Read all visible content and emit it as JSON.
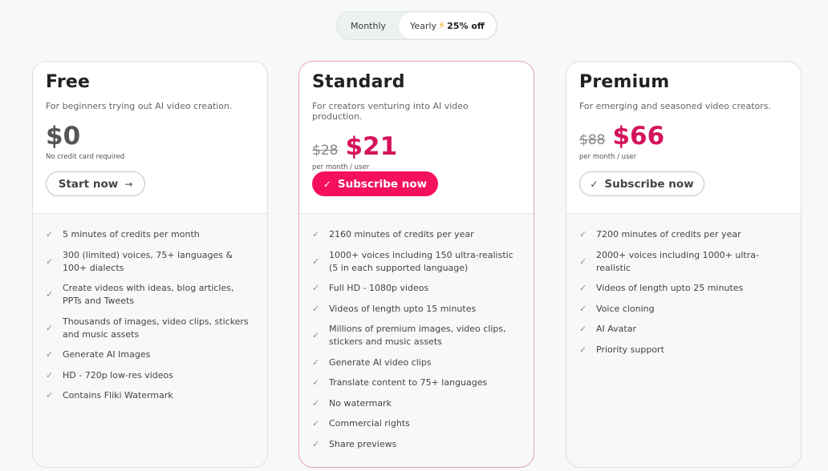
{
  "billing_toggle": {
    "monthly_label": "Monthly",
    "yearly_label": "Yearly",
    "discount_label": "25% off",
    "selected": "Yearly",
    "bolt_icon": "lightning-bolt-icon"
  },
  "plans": [
    {
      "name": "Free",
      "description": "For beginners trying out AI video creation.",
      "price": "$0",
      "price_note": "No credit card required",
      "cta_label": "Start now",
      "cta_icon": "→",
      "features": [
        "5 minutes of credits per month",
        "300 (limited) voices, 75+ languages & 100+ dialects",
        "Create videos with ideas, blog articles, PPTs and Tweets",
        "Thousands of images, video clips, stickers and music assets",
        "Generate AI Images",
        "HD - 720p low-res videos",
        "Contains Fliki Watermark"
      ]
    },
    {
      "name": "Standard",
      "description": "For creators venturing into AI video production.",
      "old_price": "$28",
      "price": "$21",
      "price_note": "per month / user",
      "cta_label": "Subscribe now",
      "cta_icon": "✓",
      "highlighted": true,
      "features": [
        "2160 minutes of credits per year",
        "1000+ voices including 150 ultra-realistic (5 in each supported language)",
        "Full HD - 1080p videos",
        "Videos of length upto 15 minutes",
        "Millions of premium images, video clips, stickers and music assets",
        "Generate AI video clips",
        "Translate content to 75+ languages",
        "No watermark",
        "Commercial rights",
        "Share previews"
      ]
    },
    {
      "name": "Premium",
      "description": "For emerging and seasoned video creators.",
      "old_price": "$88",
      "price": "$66",
      "price_note": "per month / user",
      "cta_label": "Subscribe now",
      "cta_icon": "✓",
      "features": [
        "7200 minutes of credits per year",
        "2000+ voices including 1000+ ultra-realistic",
        "Videos of length upto 25 minutes",
        "Voice cloning",
        "AI Avatar",
        "Priority support"
      ]
    }
  ],
  "colors": {
    "accent": "#f5105c",
    "price": "#d4145a",
    "bolt": "#f1a91e"
  },
  "check_icon": "✓"
}
